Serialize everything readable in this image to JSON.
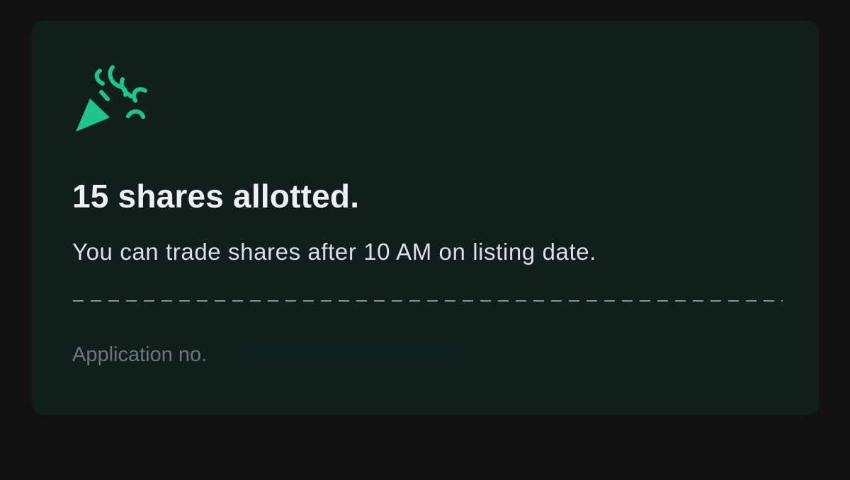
{
  "colors": {
    "page_background": "#121212",
    "card_background": "#111f1c",
    "accent": "#1ec58a",
    "title_text": "#eef0f4",
    "subtitle_text": "#dcdfe3",
    "muted_text": "#6f7577"
  },
  "icon": "party-popper-icon",
  "allotment": {
    "title": "15 shares allotted.",
    "message": "You can trade shares after 10 AM on listing date.",
    "application_label": "Application no."
  }
}
